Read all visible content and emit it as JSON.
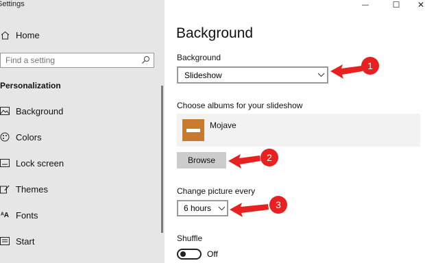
{
  "window": {
    "title": "Settings",
    "controls": [
      "—",
      "☐",
      "✕"
    ]
  },
  "sidebar": {
    "home_label": "Home",
    "search_placeholder": "Find a setting",
    "section": "Personalization",
    "items": [
      {
        "label": "Background",
        "icon": "picture-icon"
      },
      {
        "label": "Colors",
        "icon": "palette-icon"
      },
      {
        "label": "Lock screen",
        "icon": "lock-screen-icon"
      },
      {
        "label": "Themes",
        "icon": "brush-icon"
      },
      {
        "label": "Fonts",
        "icon": "font-icon"
      },
      {
        "label": "Start",
        "icon": "start-icon"
      }
    ]
  },
  "main": {
    "title": "Background",
    "background_label": "Background",
    "background_value": "Slideshow",
    "albums_label": "Choose albums for your slideshow",
    "album_name": "Mojave",
    "browse_label": "Browse",
    "interval_label": "Change picture every",
    "interval_value": "6 hours",
    "shuffle_label": "Shuffle",
    "shuffle_state": "Off"
  },
  "annotations": [
    "1",
    "2",
    "3"
  ],
  "colors": {
    "callout_red": "#e8201f",
    "album_orange": "#c87a2e"
  }
}
